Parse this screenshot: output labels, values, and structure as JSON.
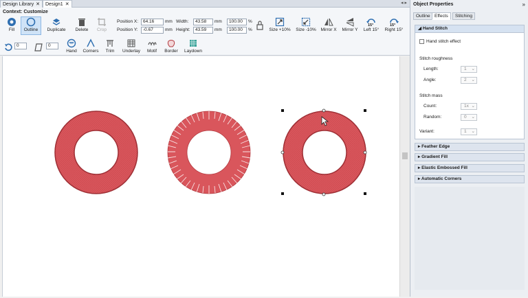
{
  "tabs": [
    {
      "label": "Design Library"
    },
    {
      "label": "Design1"
    }
  ],
  "context_title": "Context: Customize",
  "toolbar": {
    "fill": "Fill",
    "outline": "Outline",
    "duplicate": "Duplicate",
    "delete": "Delete",
    "crop": "Crop",
    "position_x_label": "Position X:",
    "position_x_value": "64.16",
    "position_y_label": "Position Y:",
    "position_y_value": "-0.67",
    "unit": "mm",
    "width_label": "Width:",
    "width_value": "43.58",
    "height_label": "Height:",
    "height_value": "43.59",
    "scale_w": "100.00",
    "scale_h": "100.00",
    "percent": "%",
    "size_up": "Size +10%",
    "size_down": "Size -10%",
    "mirror_x": "Mirror X",
    "mirror_y": "Mirror Y",
    "left15": "Left 15°",
    "right15": "Right 15°",
    "rotate_badge": "15°",
    "rotate_value": "0",
    "skew_value": "0",
    "hand": "Hand",
    "corners": "Corners",
    "trim": "Trim",
    "underlay": "Underlay",
    "motif": "Motif",
    "border": "Border",
    "laydown": "Laydown"
  },
  "panel": {
    "title": "Object Properties",
    "tabs": [
      "Outline",
      "Effects",
      "Stitching"
    ],
    "hand_stitch": "Hand Stitch",
    "hand_stitch_effect": "Hand stitch effect",
    "stitch_roughness": "Stitch roughness",
    "length_label": "Length:",
    "length_value": "1",
    "angle_label": "Angle:",
    "angle_value": "2",
    "stitch_mass": "Stitch mass",
    "count_label": "Count:",
    "count_value": "1x",
    "random_label": "Random:",
    "random_value": "0",
    "variant_label": "Variant:",
    "variant_value": "1",
    "collapsed_sections": [
      "Feather Edge",
      "Gradient Fill",
      "Elastic Embossed Fill",
      "Automatic Corners"
    ]
  },
  "colors": {
    "ring_fill": "#d9565c",
    "ring_edge": "#9e2f35",
    "accent": "#2f6fb1"
  }
}
